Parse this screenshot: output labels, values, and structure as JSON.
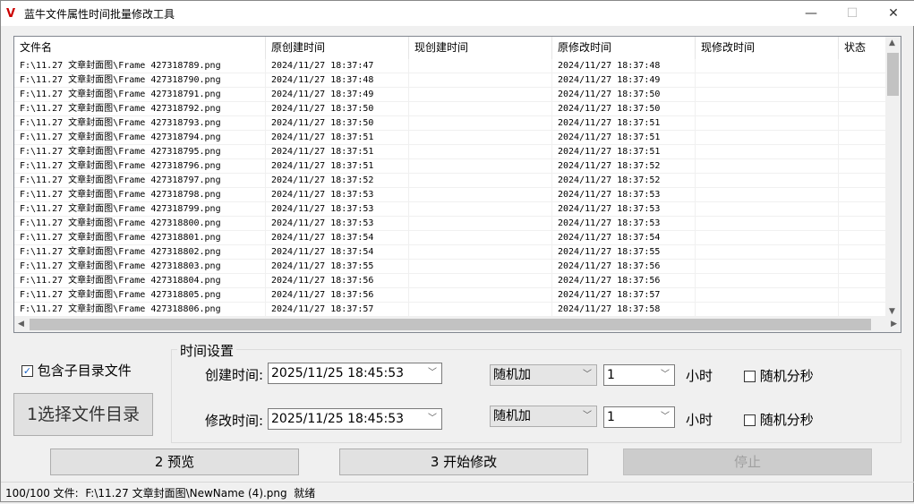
{
  "window": {
    "title": "蓝牛文件属性时间批量修改工具",
    "minimize": "—",
    "maximize": "☐",
    "close": "✕"
  },
  "table": {
    "columns": [
      "文件名",
      "原创建时间",
      "现创建时间",
      "原修改时间",
      "现修改时间",
      "状态"
    ],
    "rows": [
      [
        "F:\\11.27 文章封面图\\Frame 427318789.png",
        "2024/11/27 18:37:47",
        "",
        "2024/11/27 18:37:48",
        "",
        ""
      ],
      [
        "F:\\11.27 文章封面图\\Frame 427318790.png",
        "2024/11/27 18:37:48",
        "",
        "2024/11/27 18:37:49",
        "",
        ""
      ],
      [
        "F:\\11.27 文章封面图\\Frame 427318791.png",
        "2024/11/27 18:37:49",
        "",
        "2024/11/27 18:37:50",
        "",
        ""
      ],
      [
        "F:\\11.27 文章封面图\\Frame 427318792.png",
        "2024/11/27 18:37:50",
        "",
        "2024/11/27 18:37:50",
        "",
        ""
      ],
      [
        "F:\\11.27 文章封面图\\Frame 427318793.png",
        "2024/11/27 18:37:50",
        "",
        "2024/11/27 18:37:51",
        "",
        ""
      ],
      [
        "F:\\11.27 文章封面图\\Frame 427318794.png",
        "2024/11/27 18:37:51",
        "",
        "2024/11/27 18:37:51",
        "",
        ""
      ],
      [
        "F:\\11.27 文章封面图\\Frame 427318795.png",
        "2024/11/27 18:37:51",
        "",
        "2024/11/27 18:37:51",
        "",
        ""
      ],
      [
        "F:\\11.27 文章封面图\\Frame 427318796.png",
        "2024/11/27 18:37:51",
        "",
        "2024/11/27 18:37:52",
        "",
        ""
      ],
      [
        "F:\\11.27 文章封面图\\Frame 427318797.png",
        "2024/11/27 18:37:52",
        "",
        "2024/11/27 18:37:52",
        "",
        ""
      ],
      [
        "F:\\11.27 文章封面图\\Frame 427318798.png",
        "2024/11/27 18:37:53",
        "",
        "2024/11/27 18:37:53",
        "",
        ""
      ],
      [
        "F:\\11.27 文章封面图\\Frame 427318799.png",
        "2024/11/27 18:37:53",
        "",
        "2024/11/27 18:37:53",
        "",
        ""
      ],
      [
        "F:\\11.27 文章封面图\\Frame 427318800.png",
        "2024/11/27 18:37:53",
        "",
        "2024/11/27 18:37:53",
        "",
        ""
      ],
      [
        "F:\\11.27 文章封面图\\Frame 427318801.png",
        "2024/11/27 18:37:54",
        "",
        "2024/11/27 18:37:54",
        "",
        ""
      ],
      [
        "F:\\11.27 文章封面图\\Frame 427318802.png",
        "2024/11/27 18:37:54",
        "",
        "2024/11/27 18:37:55",
        "",
        ""
      ],
      [
        "F:\\11.27 文章封面图\\Frame 427318803.png",
        "2024/11/27 18:37:55",
        "",
        "2024/11/27 18:37:56",
        "",
        ""
      ],
      [
        "F:\\11.27 文章封面图\\Frame 427318804.png",
        "2024/11/27 18:37:56",
        "",
        "2024/11/27 18:37:56",
        "",
        ""
      ],
      [
        "F:\\11.27 文章封面图\\Frame 427318805.png",
        "2024/11/27 18:37:56",
        "",
        "2024/11/27 18:37:57",
        "",
        ""
      ],
      [
        "F:\\11.27 文章封面图\\Frame 427318806.png",
        "2024/11/27 18:37:57",
        "",
        "2024/11/27 18:37:58",
        "",
        ""
      ]
    ]
  },
  "options": {
    "include_subdirs_label": "包含子目录文件",
    "include_subdirs_checked": true,
    "select_dir_button": "1选择文件目录"
  },
  "time_settings": {
    "title": "时间设置",
    "create": {
      "label": "创建时间:",
      "datetime": "2025/11/25 18:45:53",
      "mode": "随机加",
      "amount": "1",
      "unit": "小时",
      "random_label": "随机分秒"
    },
    "modify": {
      "label": "修改时间:",
      "datetime": "2025/11/25 18:45:53",
      "mode": "随机加",
      "amount": "1",
      "unit": "小时",
      "random_label": "随机分秒"
    }
  },
  "actions": {
    "preview": "2 预览",
    "start": "3 开始修改",
    "stop": "停止"
  },
  "status": {
    "text": "100/100 文件:  F:\\11.27 文章封面图\\NewName (4).png  就绪"
  }
}
